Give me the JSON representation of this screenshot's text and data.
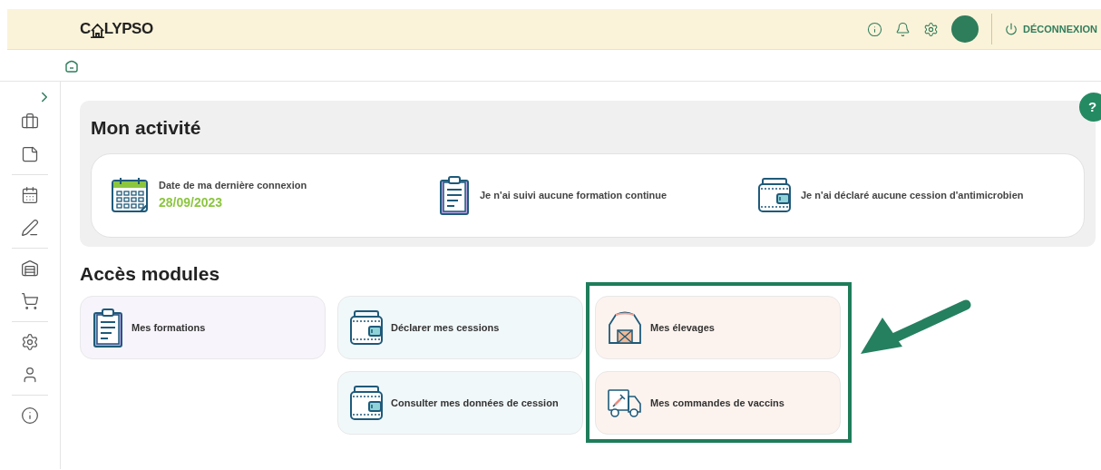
{
  "header": {
    "logo": {
      "before": "C",
      "after": "LYPSO"
    },
    "logout": "DÉCONNEXION"
  },
  "help": "?",
  "activity": {
    "title": "Mon activité",
    "items": [
      {
        "kind": "calendar",
        "label": "Date de ma dernière connexion",
        "value": "28/09/2023"
      },
      {
        "kind": "clipboard",
        "label": "Je n'ai suivi aucune formation continue"
      },
      {
        "kind": "wallet",
        "label": "Je n'ai déclaré aucune cession d'antimicrobien"
      }
    ]
  },
  "modules": {
    "title": "Accès modules",
    "columns": [
      {
        "highlighted": false,
        "items": [
          {
            "kind": "clipboard",
            "label": "Mes formations",
            "color": "#f8f4fb"
          }
        ]
      },
      {
        "highlighted": false,
        "items": [
          {
            "kind": "wallet",
            "label": "Déclarer mes cessions",
            "color": "#f1f8fa"
          },
          {
            "kind": "wallet",
            "label": "Consulter mes données de cession",
            "color": "#f1f8fa"
          }
        ]
      },
      {
        "highlighted": true,
        "items": [
          {
            "kind": "barn",
            "label": "Mes élevages",
            "color": "#fdf3ee"
          },
          {
            "kind": "truck",
            "label": "Mes commandes de vaccins",
            "color": "#fdf3ee"
          }
        ]
      }
    ]
  }
}
